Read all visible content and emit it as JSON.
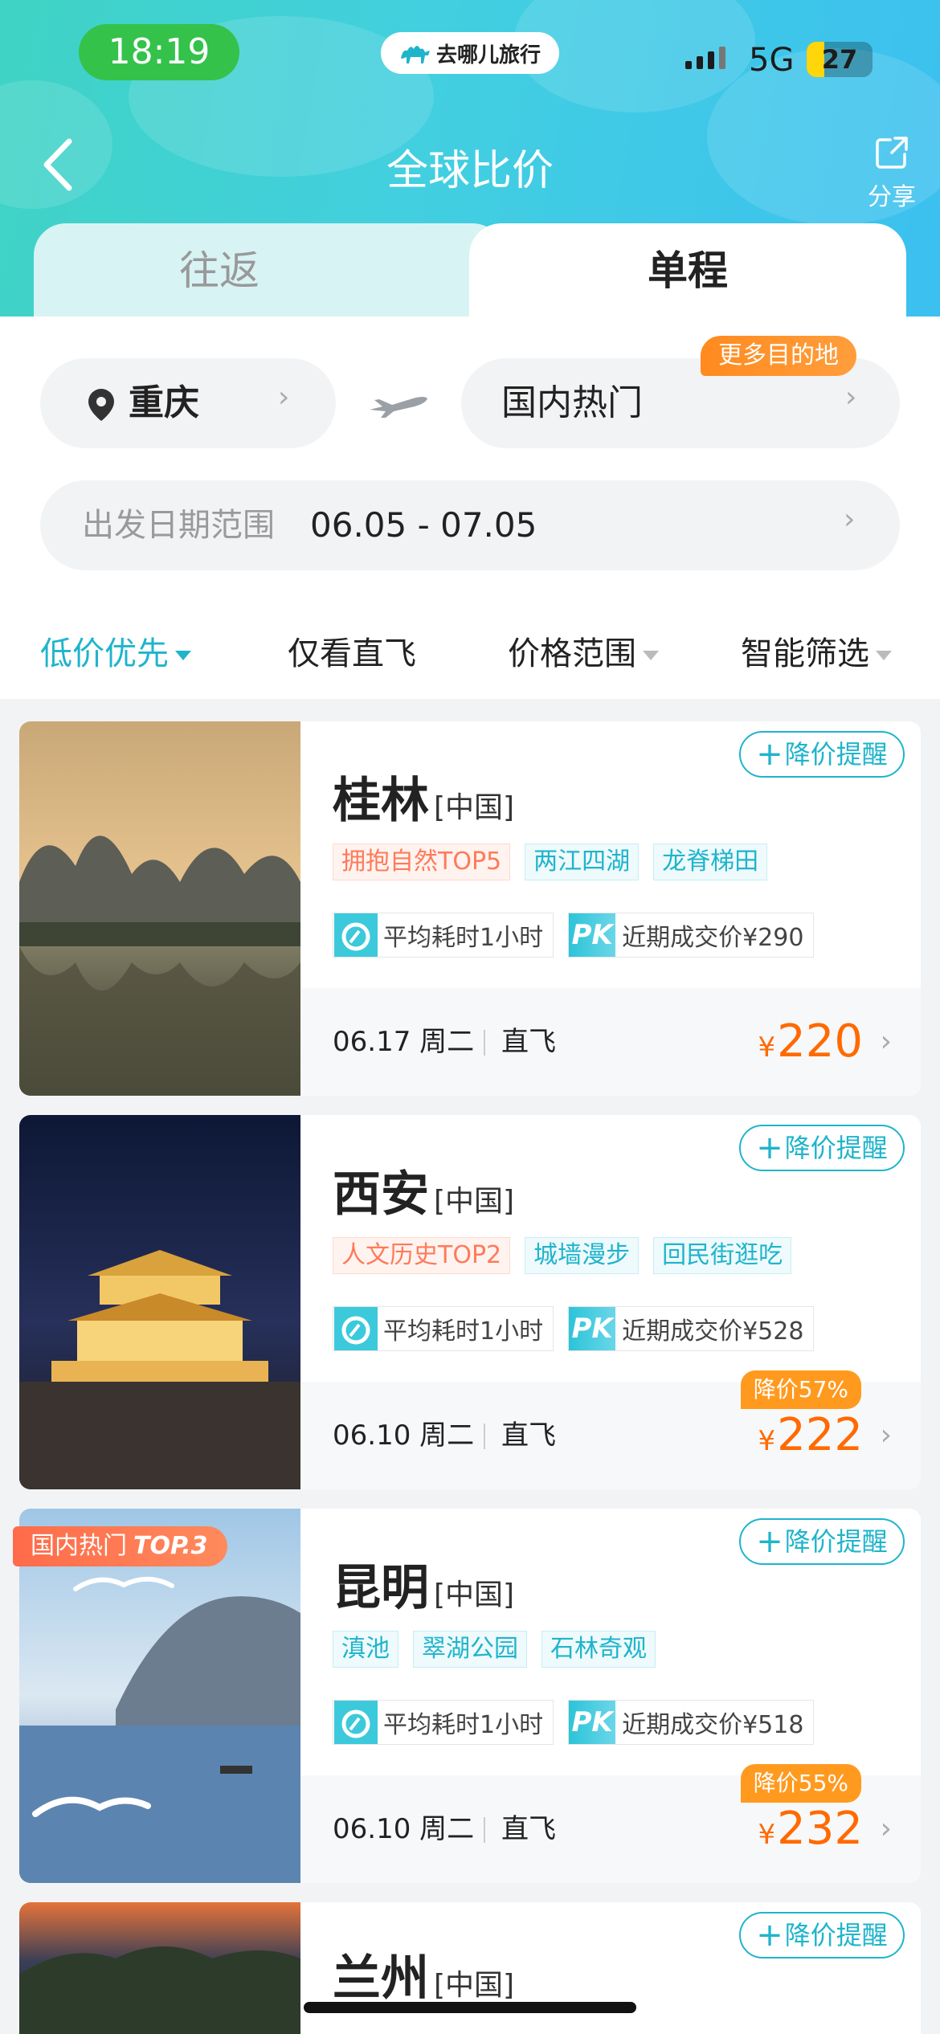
{
  "status_bar": {
    "time": "18:19",
    "app_island": "去哪儿旅行",
    "network": "5G",
    "battery": "27"
  },
  "nav": {
    "title": "全球比价",
    "share": "分享"
  },
  "tabs": [
    {
      "label": "往返"
    },
    {
      "label": "单程"
    }
  ],
  "search": {
    "origin": "重庆",
    "destination": "国内热门",
    "more_destinations": "更多目的地",
    "date_label": "出发日期范围",
    "date_value": "06.05 - 07.05"
  },
  "filters": [
    {
      "label": "低价优先",
      "active": true
    },
    {
      "label": "仅看直飞",
      "active": false
    },
    {
      "label": "价格范围",
      "active": false
    },
    {
      "label": "智能筛选",
      "active": false
    }
  ],
  "results": [
    {
      "city": "桂林",
      "country": "[中国]",
      "alert": "降价提醒",
      "tags": [
        {
          "text": "拥抱自然TOP5",
          "color": "orange"
        },
        {
          "text": "两江四湖",
          "color": "teal"
        },
        {
          "text": "龙脊梯田",
          "color": "teal"
        }
      ],
      "avg_time": "平均耗时1小时",
      "recent_deal": "近期成交价¥290",
      "date": "06.17 周二",
      "flight_type": "直飞",
      "currency": "¥",
      "price": "220",
      "drop": ""
    },
    {
      "city": "西安",
      "country": "[中国]",
      "alert": "降价提醒",
      "tags": [
        {
          "text": "人文历史TOP2",
          "color": "orange"
        },
        {
          "text": "城墙漫步",
          "color": "teal"
        },
        {
          "text": "回民街逛吃",
          "color": "teal"
        }
      ],
      "avg_time": "平均耗时1小时",
      "recent_deal": "近期成交价¥528",
      "date": "06.10 周二",
      "flight_type": "直飞",
      "currency": "¥",
      "price": "222",
      "drop": "降价57%"
    },
    {
      "city": "昆明",
      "country": "[中国]",
      "alert": "降价提醒",
      "hot_label": "国内热门",
      "hot_rank": "TOP.3",
      "tags": [
        {
          "text": "滇池",
          "color": "teal"
        },
        {
          "text": "翠湖公园",
          "color": "teal"
        },
        {
          "text": "石林奇观",
          "color": "teal"
        }
      ],
      "avg_time": "平均耗时1小时",
      "recent_deal": "近期成交价¥518",
      "date": "06.10 周二",
      "flight_type": "直飞",
      "currency": "¥",
      "price": "232",
      "drop": "降价55%"
    },
    {
      "city": "兰州",
      "country": "[中国]",
      "alert": "降价提醒"
    }
  ],
  "colors": {
    "accent": "#1fb4cc",
    "price": "#ff6a00",
    "badge": "#ff9a1f"
  },
  "icons": [
    "back-arrow-icon",
    "share-icon",
    "location-pin-icon",
    "plane-icon",
    "chevron-right-icon",
    "clock-icon",
    "pk-icon",
    "plus-icon",
    "dropdown-triangle-icon"
  ]
}
